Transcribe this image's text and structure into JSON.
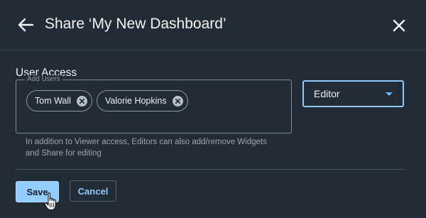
{
  "header": {
    "title": "Share ‘My New Dashboard’",
    "back_icon": "arrow-left-icon",
    "close_icon": "close-icon"
  },
  "user_access": {
    "section_title": "User Access",
    "add_users_label": "Add Users",
    "chips": [
      {
        "label": "Tom Wall",
        "remove_icon": "remove-circle-icon"
      },
      {
        "label": "Valorie Hopkins",
        "remove_icon": "remove-circle-icon"
      }
    ],
    "role": {
      "selected": "Editor",
      "caret_icon": "caret-down-icon"
    },
    "helper_text": "In addition to Viewer access, Editors can also add/remove Widgets and Share for editing"
  },
  "footer": {
    "save_label": "Save",
    "cancel_label": "Cancel"
  },
  "colors": {
    "background": "#222c37",
    "primary": "#92cdff",
    "accent": "#8cc8ff"
  }
}
